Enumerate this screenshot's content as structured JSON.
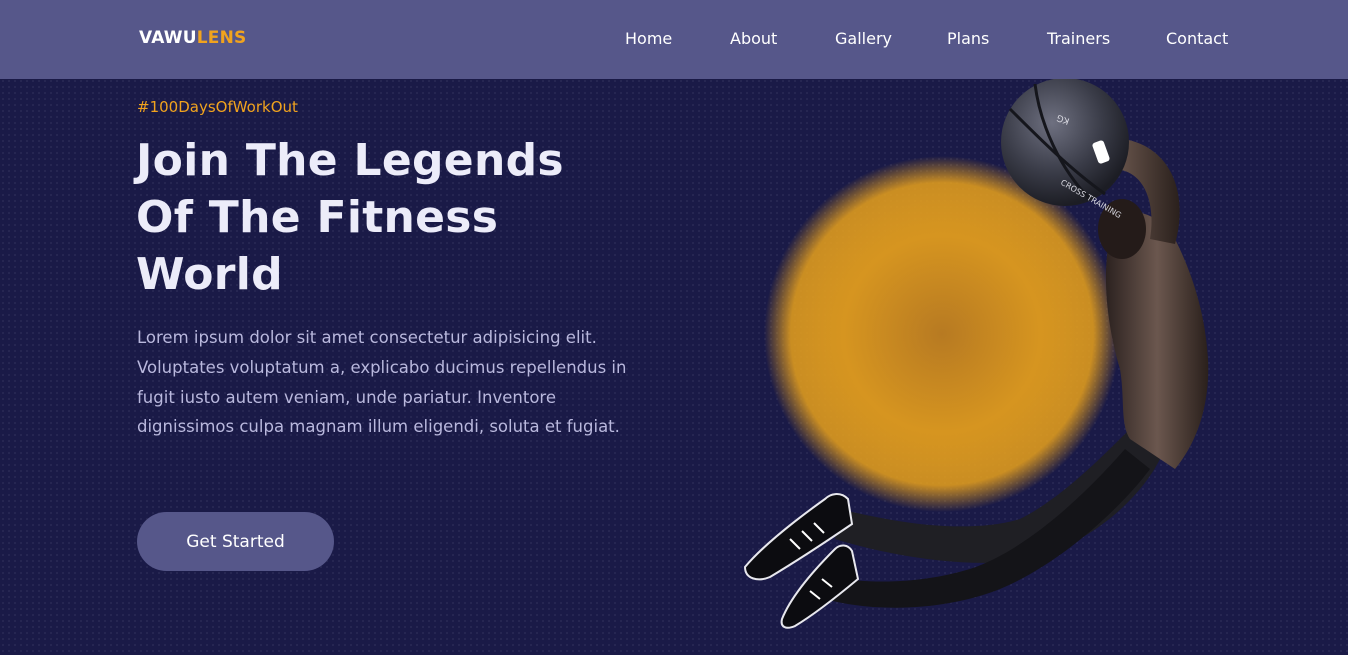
{
  "brand": {
    "name_part1": "VAWU",
    "name_part2": "LENS",
    "accent_color": "#f1a31e"
  },
  "nav": {
    "items": [
      {
        "label": "Home"
      },
      {
        "label": "About"
      },
      {
        "label": "Gallery"
      },
      {
        "label": "Plans"
      },
      {
        "label": "Trainers"
      },
      {
        "label": "Contact"
      }
    ]
  },
  "hero": {
    "hashtag": "#100DaysOfWorkOut",
    "headline_lines": [
      "Join The Legends",
      "Of The Fitness",
      "World"
    ],
    "description": "Lorem ipsum dolor sit amet consectetur adipisicing elit. Voluptates voluptatum a, explicabo ducimus repellendus in fugit iusto autem veniam, unde pariatur. Inventore dignissimos culpa magnam illum eligendi, soluta et fugiat.",
    "cta_label": "Get Started",
    "ball_text": "CROSS TRAINING",
    "ball_weight": "KG"
  },
  "colors": {
    "background": "#1a1a47",
    "navbar": "#56578a",
    "glow": "#f1a31e",
    "heading": "#ececf9",
    "body_text": "#b9b8dd"
  }
}
